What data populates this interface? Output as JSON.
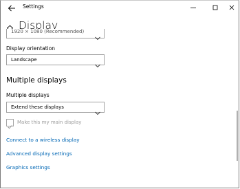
{
  "window": {
    "title": "Settings",
    "controls": {
      "minimize": "minimize-icon",
      "maximize": "maximize-icon",
      "close": "close-icon"
    }
  },
  "header": {
    "icon": "home-icon",
    "title": "Display"
  },
  "resolution": {
    "value": "1920 × 1080 (Recommended)"
  },
  "orientation": {
    "label": "Display orientation",
    "value": "Landscape"
  },
  "multiple_displays": {
    "section_title": "Multiple displays",
    "label": "Multiple displays",
    "value": "Extend these displays",
    "main_display_checkbox": {
      "label": "Make this my main display",
      "checked": true,
      "disabled": true
    }
  },
  "links": [
    {
      "label": "Connect to a wireless display"
    },
    {
      "label": "Advanced display settings"
    },
    {
      "label": "Graphics settings"
    }
  ],
  "colors": {
    "link": "#0066b4",
    "disabled_text": "#9a9a9a"
  }
}
